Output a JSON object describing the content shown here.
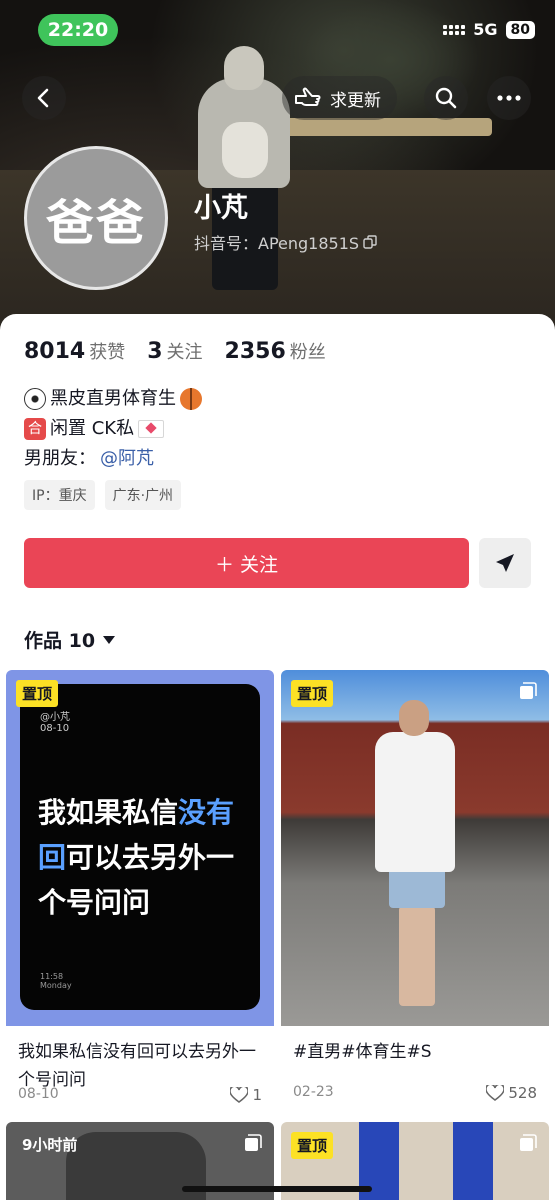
{
  "status": {
    "time": "22:20",
    "network": "5G",
    "battery": "80"
  },
  "nav": {
    "update_label": "求更新"
  },
  "profile": {
    "avatar_text": "爸爸",
    "nickname": "小芃",
    "douyin_id": "抖音号：APeng1851S"
  },
  "stats": [
    {
      "num": "8014",
      "label": "获赞"
    },
    {
      "num": "3",
      "label": "关注"
    },
    {
      "num": "2356",
      "label": "粉丝"
    }
  ],
  "bio": {
    "line1": "黑皮直男体育生",
    "line2_closed": "合",
    "line2": "闲置 CK私",
    "line3_prefix": "男朋友：",
    "line3_mention": "@阿芃"
  },
  "tags": [
    "IP：重庆",
    "广东·广州"
  ],
  "actions": {
    "follow": "＋ 关注"
  },
  "tab": {
    "label": "作品 10"
  },
  "works": [
    {
      "pin": "置顶",
      "phone_user": "@小芃",
      "phone_date": "08-10",
      "phone_time": "11:58",
      "phone_day": "Monday",
      "phone_text_a": "我如果私信",
      "phone_text_b": "没",
      "phone_text_c": "有回",
      "phone_text_d": "可以去另外一个号问问",
      "caption": "我如果私信没有回可以去另外一个号问问",
      "date": "08-10",
      "likes": "1"
    },
    {
      "pin": "置顶",
      "caption": "#直男#体育生#S",
      "date": "02-23",
      "likes": "528"
    },
    {
      "badge": "9小时前"
    },
    {
      "pin": "置顶"
    }
  ],
  "colors": {
    "follow": "#ea4556",
    "pin": "#fce125",
    "status_pill": "#3fc45b"
  }
}
